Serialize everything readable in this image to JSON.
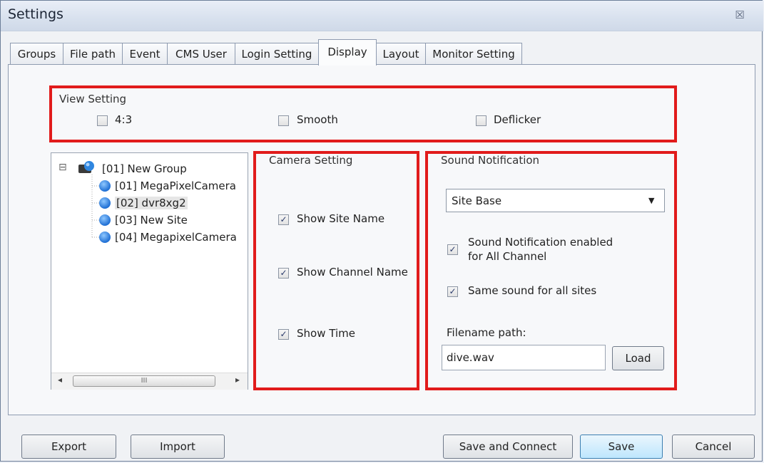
{
  "window": {
    "title": "Settings",
    "close_glyph": "☒"
  },
  "tabs": [
    "Groups",
    "File path",
    "Event",
    "CMS User",
    "Login Setting",
    "Display",
    "Layout",
    "Monitor Setting"
  ],
  "active_tab": "Display",
  "view_setting": {
    "label": "View Setting",
    "options": [
      {
        "label": "4:3",
        "checked": false
      },
      {
        "label": "Smooth",
        "checked": false
      },
      {
        "label": "Deflicker",
        "checked": false
      }
    ]
  },
  "tree": {
    "root": "[01] New Group",
    "collapse_glyph": "⊟",
    "items": [
      "[01] MegaPixelCamera",
      "[02] dvr8xg2",
      "[03] New Site",
      "[04] MegapixelCamera"
    ],
    "scroll_left": "◂",
    "scroll_right": "▸",
    "scroll_grip": "III"
  },
  "camera_setting": {
    "label": "Camera Setting",
    "options": [
      {
        "label": "Show Site Name",
        "checked": true
      },
      {
        "label": "Show Channel Name",
        "checked": true
      },
      {
        "label": "Show Time",
        "checked": true
      }
    ]
  },
  "sound_notification": {
    "label": "Sound Notification",
    "mode_selected": "Site Base",
    "dropdown_arrow": "▼",
    "enabled_all_line1": "Sound Notification enabled",
    "enabled_all_line2": "for All Channel",
    "same_sound_label": "Same sound for all sites",
    "filename_label": "Filename path:",
    "filename_value": "dive.wav",
    "load_label": "Load"
  },
  "footer": {
    "export_label": "Export",
    "import_label": "Import",
    "save_connect_label": "Save and Connect",
    "save_label": "Save",
    "cancel_label": "Cancel"
  },
  "colors": {
    "highlight_box": "#e11b1b",
    "check": "#2a3a6a"
  },
  "check_glyph": "✓"
}
